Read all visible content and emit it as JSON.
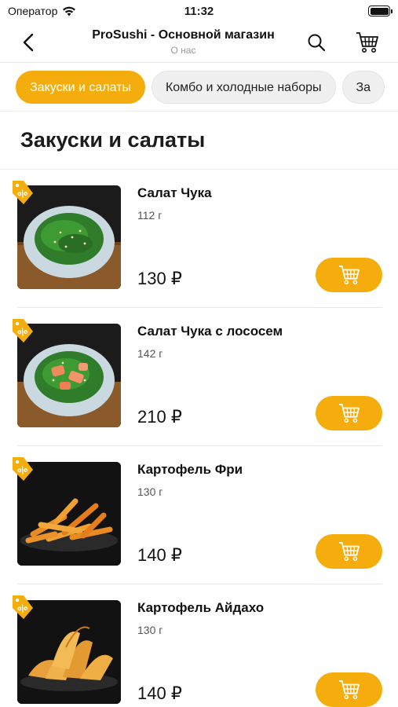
{
  "status_bar": {
    "carrier": "Оператор",
    "time": "11:32"
  },
  "nav": {
    "title": "ProSushi - Основной магазин",
    "subtitle": "О нас",
    "icons": {
      "back": "chevron-left-icon",
      "search": "search-icon",
      "cart": "cart-icon"
    }
  },
  "tabs": [
    {
      "label": "Закуски и салаты",
      "active": true
    },
    {
      "label": "Комбо и холодные наборы",
      "active": false
    },
    {
      "label": "За",
      "active": false
    }
  ],
  "section": {
    "title": "Закуски и салаты"
  },
  "products": [
    {
      "name": "Салат Чука",
      "weight": "112 г",
      "price": "130 ₽",
      "image": "seaweed-salad"
    },
    {
      "name": "Салат Чука с лососем",
      "weight": "142 г",
      "price": "210 ₽",
      "image": "salmon-seaweed-salad"
    },
    {
      "name": "Картофель Фри",
      "weight": "130 г",
      "price": "140 ₽",
      "image": "french-fries"
    },
    {
      "name": "Картофель Айдахо",
      "weight": "130 г",
      "price": "140 ₽",
      "image": "potato-wedges"
    }
  ],
  "colors": {
    "accent": "#f5ad0e",
    "text": "#1c1c1e",
    "muted": "#9a9a9a"
  }
}
